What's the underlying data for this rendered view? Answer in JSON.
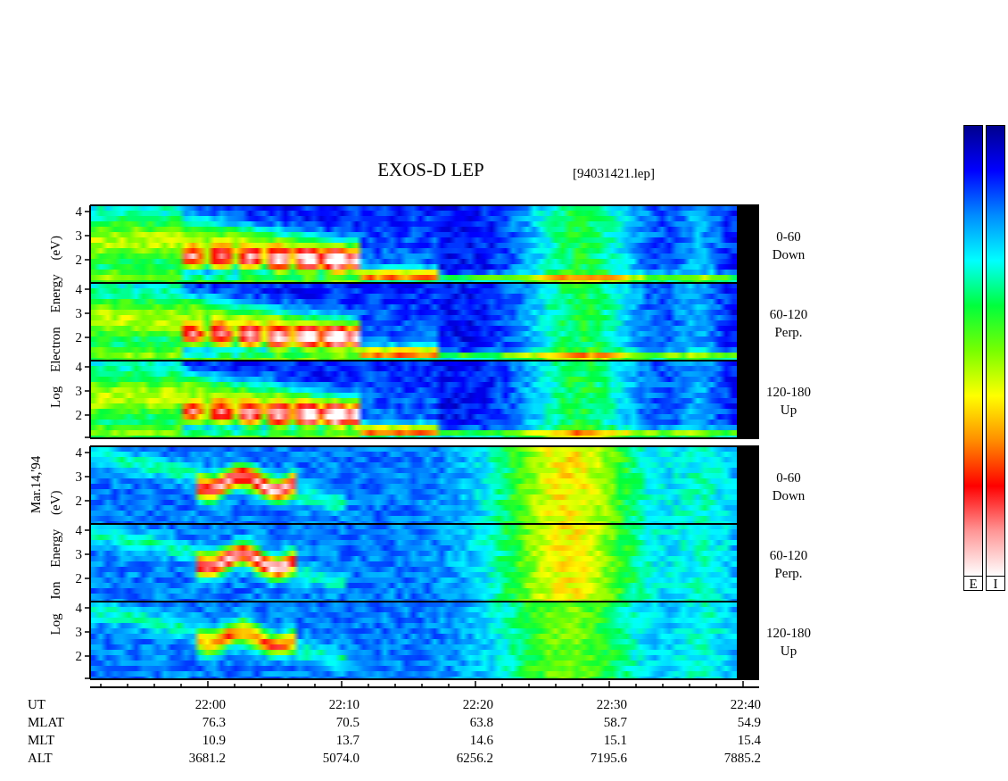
{
  "title": "EXOS-D LEP",
  "file_label": "[94031421.lep]",
  "date_label": "Mar.14,'94",
  "groups": [
    {
      "kind": "electron",
      "axis_label": "Log Electron Energy (eV)",
      "panels": [
        {
          "angle": "0-60",
          "direction": "Down",
          "yticks": [
            "4",
            "3",
            "2"
          ]
        },
        {
          "angle": "60-120",
          "direction": "Perp.",
          "yticks": [
            "4",
            "3",
            "2"
          ]
        },
        {
          "angle": "120-180",
          "direction": "Up",
          "yticks": [
            "4",
            "3",
            "2"
          ]
        }
      ]
    },
    {
      "kind": "ion",
      "axis_label": "Log Ion Energy (eV)",
      "panels": [
        {
          "angle": "0-60",
          "direction": "Down",
          "yticks": [
            "4",
            "3",
            "2"
          ]
        },
        {
          "angle": "60-120",
          "direction": "Perp.",
          "yticks": [
            "4",
            "3",
            "2"
          ]
        },
        {
          "angle": "120-180",
          "direction": "Up",
          "yticks": [
            "4",
            "3",
            "2"
          ]
        }
      ]
    }
  ],
  "x_axis": {
    "rows": [
      {
        "label": "UT",
        "values": [
          "22:00",
          "22:10",
          "22:20",
          "22:30",
          "22:40"
        ]
      },
      {
        "label": "MLAT",
        "values": [
          "76.3",
          "70.5",
          "63.8",
          "58.7",
          "54.9"
        ]
      },
      {
        "label": "MLT",
        "values": [
          "10.9",
          "13.7",
          "14.6",
          "15.1",
          "15.4"
        ]
      },
      {
        "label": "ALT",
        "values": [
          "3681.2",
          "5074.0",
          "6256.2",
          "7195.6",
          "7885.2"
        ]
      }
    ]
  },
  "colorbars": [
    {
      "label": "E"
    },
    {
      "label": "I"
    }
  ]
}
